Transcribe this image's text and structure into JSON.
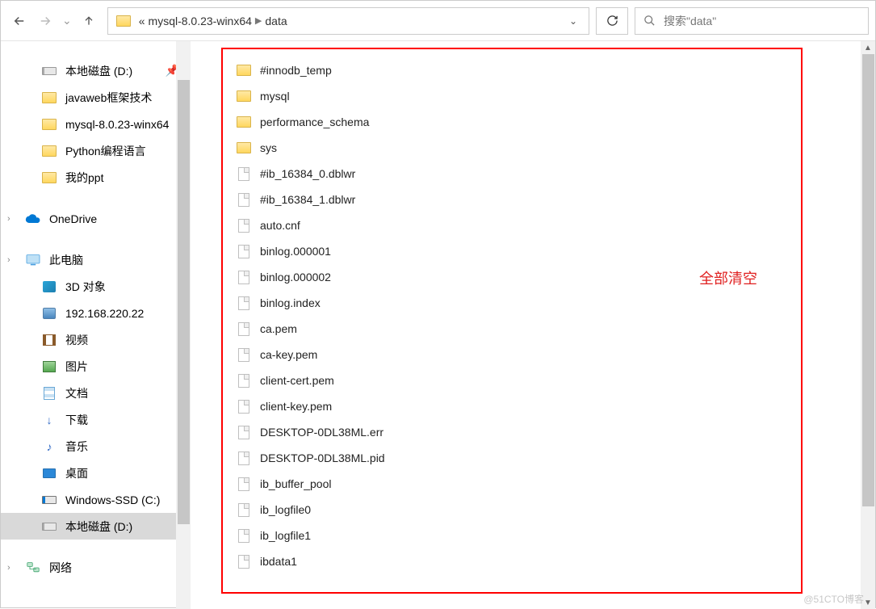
{
  "toolbar": {
    "breadcrumb_prefix": "«",
    "crumbs": [
      "mysql-8.0.23-winx64",
      "data"
    ],
    "search_placeholder": "搜索\"data\""
  },
  "sidebar": {
    "quick": [
      {
        "label": "本地磁盘 (D:)",
        "icon": "drive",
        "pinned": true
      },
      {
        "label": "javaweb框架技术",
        "icon": "folder"
      },
      {
        "label": "mysql-8.0.23-winx64",
        "icon": "folder"
      },
      {
        "label": "Python编程语言",
        "icon": "folder"
      },
      {
        "label": "我的ppt",
        "icon": "folder"
      }
    ],
    "onedrive": "OneDrive",
    "thispc": "此电脑",
    "pc_items": [
      {
        "label": "3D 对象",
        "icon": "3d"
      },
      {
        "label": "192.168.220.22",
        "icon": "netloc"
      },
      {
        "label": "视频",
        "icon": "video"
      },
      {
        "label": "图片",
        "icon": "image"
      },
      {
        "label": "文档",
        "icon": "doc"
      },
      {
        "label": "下载",
        "icon": "download"
      },
      {
        "label": "音乐",
        "icon": "music"
      },
      {
        "label": "桌面",
        "icon": "desktop"
      },
      {
        "label": "Windows-SSD (C:)",
        "icon": "ssd"
      },
      {
        "label": "本地磁盘 (D:)",
        "icon": "drive",
        "selected": true
      }
    ],
    "network": "网络"
  },
  "annotation": "全部清空",
  "files": [
    {
      "name": "#innodb_temp",
      "type": "folder"
    },
    {
      "name": "mysql",
      "type": "folder"
    },
    {
      "name": "performance_schema",
      "type": "folder"
    },
    {
      "name": "sys",
      "type": "folder"
    },
    {
      "name": "#ib_16384_0.dblwr",
      "type": "file"
    },
    {
      "name": "#ib_16384_1.dblwr",
      "type": "file"
    },
    {
      "name": "auto.cnf",
      "type": "file"
    },
    {
      "name": "binlog.000001",
      "type": "file"
    },
    {
      "name": "binlog.000002",
      "type": "file"
    },
    {
      "name": "binlog.index",
      "type": "file"
    },
    {
      "name": "ca.pem",
      "type": "file"
    },
    {
      "name": "ca-key.pem",
      "type": "file"
    },
    {
      "name": "client-cert.pem",
      "type": "file"
    },
    {
      "name": "client-key.pem",
      "type": "file"
    },
    {
      "name": "DESKTOP-0DL38ML.err",
      "type": "file"
    },
    {
      "name": "DESKTOP-0DL38ML.pid",
      "type": "file"
    },
    {
      "name": "ib_buffer_pool",
      "type": "file"
    },
    {
      "name": "ib_logfile0",
      "type": "file"
    },
    {
      "name": "ib_logfile1",
      "type": "file"
    },
    {
      "name": "ibdata1",
      "type": "file"
    }
  ],
  "watermark": "@51CTO博客"
}
